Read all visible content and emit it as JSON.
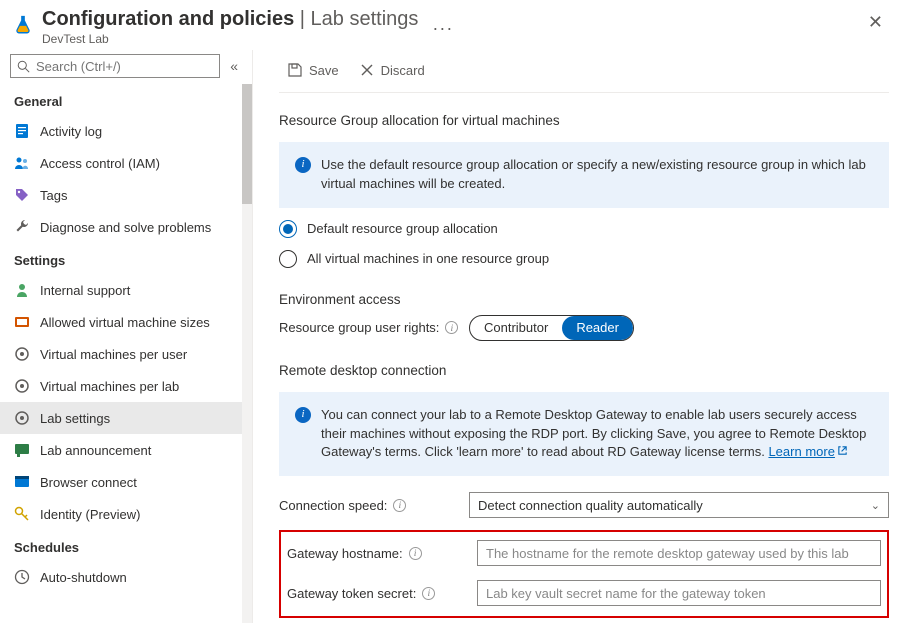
{
  "header": {
    "title_main": "Configuration and policies",
    "title_sep": " | ",
    "title_sub": "Lab settings",
    "subtitle": "DevTest Lab"
  },
  "search": {
    "placeholder": "Search (Ctrl+/)"
  },
  "sidebar": {
    "group_general": "General",
    "items_general": {
      "activity_log": "Activity log",
      "access_control": "Access control (IAM)",
      "tags": "Tags",
      "diagnose": "Diagnose and solve problems"
    },
    "group_settings": "Settings",
    "items_settings": {
      "internal_support": "Internal support",
      "allowed_sizes": "Allowed virtual machine sizes",
      "vm_per_user": "Virtual machines per user",
      "vm_per_lab": "Virtual machines per lab",
      "lab_settings": "Lab settings",
      "lab_announcement": "Lab announcement",
      "browser_connect": "Browser connect",
      "identity": "Identity (Preview)"
    },
    "group_schedules": "Schedules",
    "items_schedules": {
      "auto_shutdown": "Auto-shutdown"
    }
  },
  "toolbar": {
    "save": "Save",
    "discard": "Discard"
  },
  "sections": {
    "rg_alloc": "Resource Group allocation for virtual machines",
    "env_access": "Environment access",
    "rdp": "Remote desktop connection"
  },
  "info1": "Use the default resource group allocation or specify a new/existing resource group in which lab virtual machines will be created.",
  "radios": {
    "default_alloc": "Default resource group allocation",
    "one_rg": "All virtual machines in one resource group"
  },
  "env": {
    "label": "Resource group user rights:",
    "opt_contributor": "Contributor",
    "opt_reader": "Reader"
  },
  "info2_pre": "You can connect your lab to a Remote Desktop Gateway to enable lab users securely access their machines without exposing the RDP port. By clicking Save, you agree to Remote Desktop Gateway's terms.  Click 'learn more' to read about RD Gateway license terms. ",
  "info2_link": "Learn more",
  "fields": {
    "conn_speed_label": "Connection speed:",
    "conn_speed_value": "Detect connection quality automatically",
    "gateway_host_label": "Gateway hostname:",
    "gateway_host_placeholder": "The hostname for the remote desktop gateway used by this lab",
    "gateway_secret_label": "Gateway token secret:",
    "gateway_secret_placeholder": "Lab key vault secret name for the gateway token"
  }
}
